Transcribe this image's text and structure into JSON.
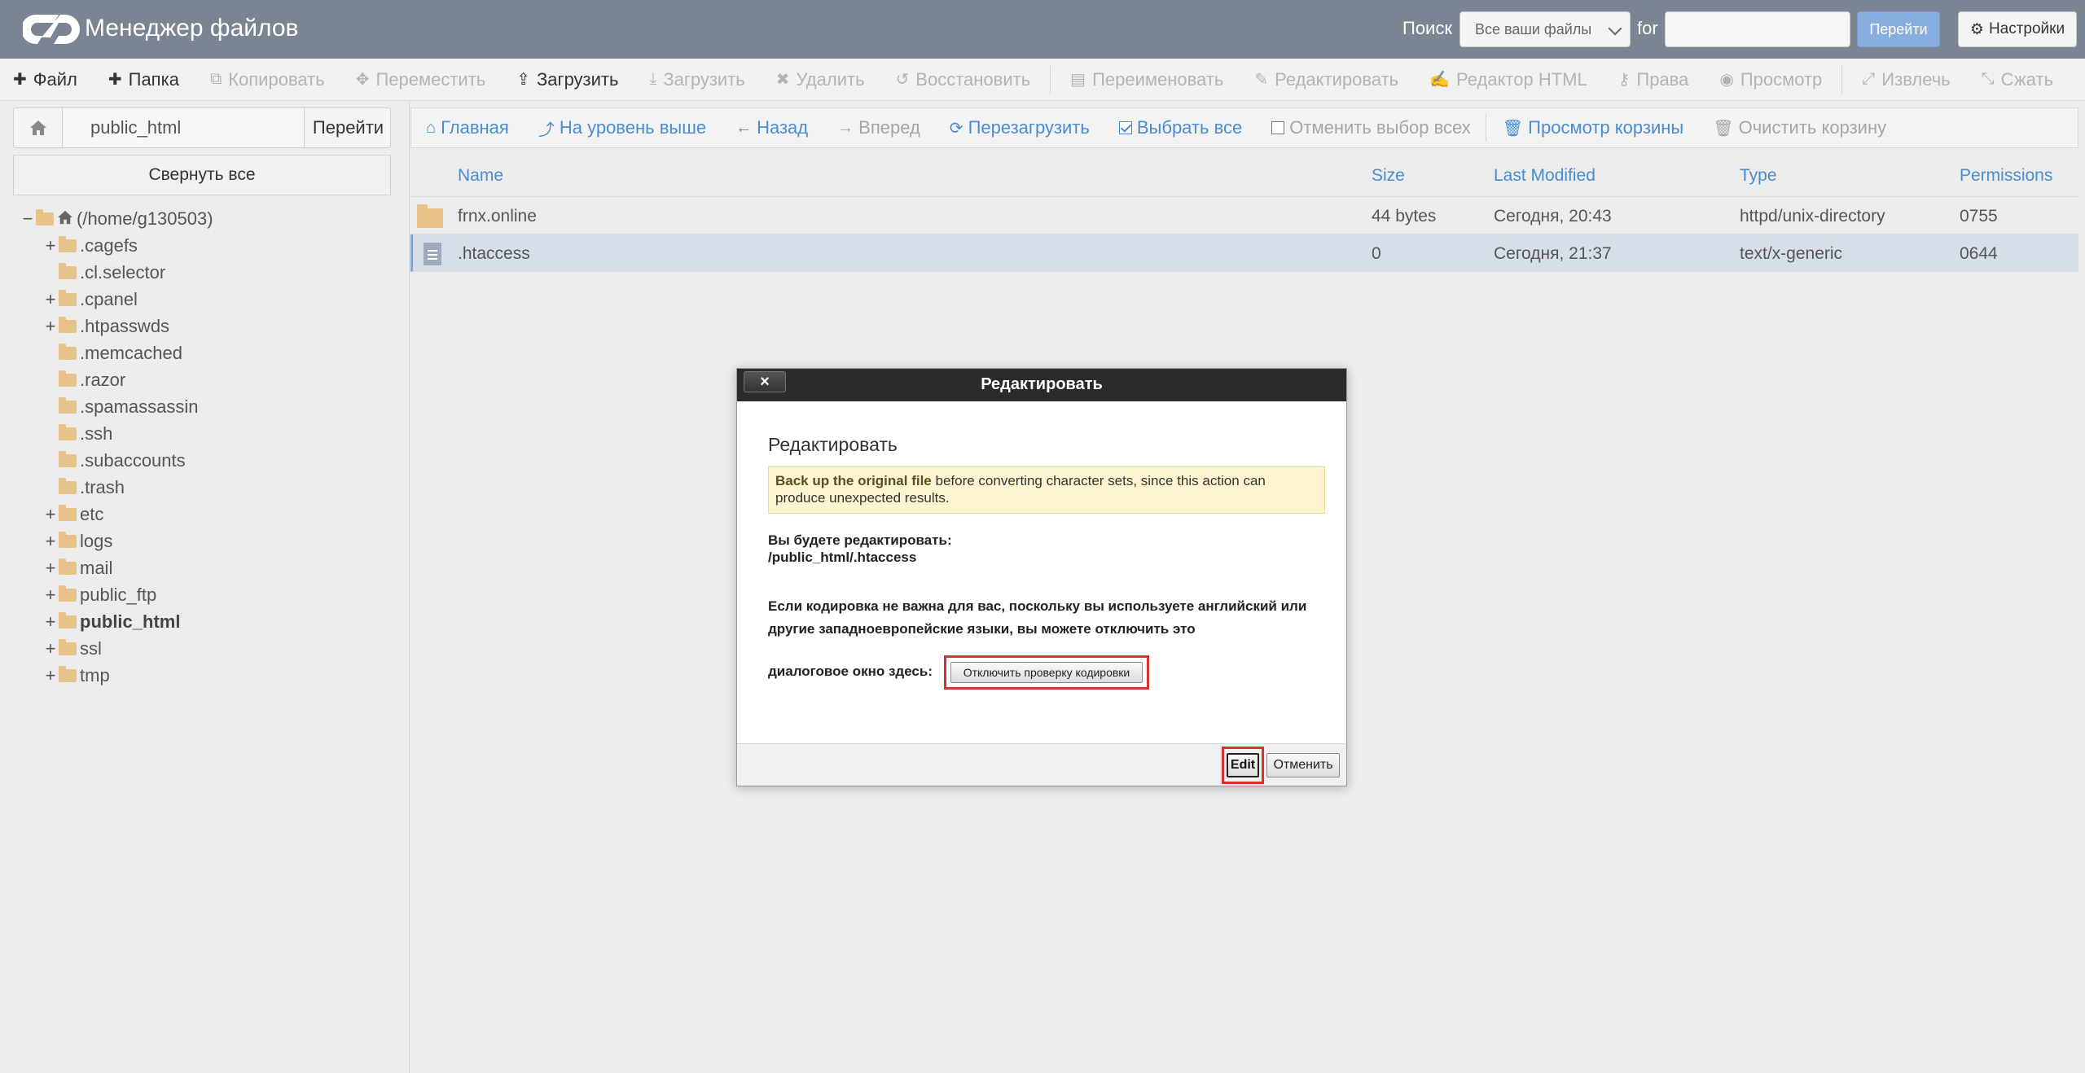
{
  "header": {
    "title": "Менеджер файлов",
    "search_label": "Поиск",
    "search_scope": "Все ваши файлы",
    "for_label": "for",
    "search_value": "",
    "go_label": "Перейти",
    "settings_label": "Настройки"
  },
  "toolbar": {
    "items": [
      {
        "label": "Файл",
        "icon": "plus-icon",
        "enabled": true
      },
      {
        "label": "Папка",
        "icon": "plus-icon",
        "enabled": true
      },
      {
        "label": "Копировать",
        "icon": "copy-icon",
        "enabled": false
      },
      {
        "label": "Переместить",
        "icon": "move-icon",
        "enabled": false
      },
      {
        "label": "Загрузить",
        "icon": "upload-icon",
        "enabled": true
      },
      {
        "label": "Загрузить",
        "icon": "download-icon",
        "enabled": false
      },
      {
        "label": "Удалить",
        "icon": "close-icon",
        "enabled": false
      },
      {
        "label": "Восстановить",
        "icon": "undo-icon",
        "enabled": false
      },
      {
        "label": "Переименовать",
        "icon": "file-icon",
        "enabled": false
      },
      {
        "label": "Редактировать",
        "icon": "pencil-icon",
        "enabled": false
      },
      {
        "label": "Редактор HTML",
        "icon": "edit-icon",
        "enabled": false
      },
      {
        "label": "Права",
        "icon": "key-icon",
        "enabled": false
      },
      {
        "label": "Просмотр",
        "icon": "eye-icon",
        "enabled": false
      },
      {
        "label": "Извлечь",
        "icon": "expand-icon",
        "enabled": false
      },
      {
        "label": "Сжать",
        "icon": "compress-icon",
        "enabled": false
      }
    ]
  },
  "left_panel": {
    "path_value": "public_html",
    "go_label": "Перейти",
    "collapse_label": "Свернуть все",
    "tree": [
      {
        "label": "(/home/g130503)",
        "level": 0,
        "expander": "−",
        "root": true
      },
      {
        "label": ".cagefs",
        "level": 1,
        "expander": "+"
      },
      {
        "label": ".cl.selector",
        "level": 1,
        "expander": ""
      },
      {
        "label": ".cpanel",
        "level": 1,
        "expander": "+"
      },
      {
        "label": ".htpasswds",
        "level": 1,
        "expander": "+"
      },
      {
        "label": ".memcached",
        "level": 1,
        "expander": ""
      },
      {
        "label": ".razor",
        "level": 1,
        "expander": ""
      },
      {
        "label": ".spamassassin",
        "level": 1,
        "expander": ""
      },
      {
        "label": ".ssh",
        "level": 1,
        "expander": ""
      },
      {
        "label": ".subaccounts",
        "level": 1,
        "expander": ""
      },
      {
        "label": ".trash",
        "level": 1,
        "expander": ""
      },
      {
        "label": "etc",
        "level": 1,
        "expander": "+"
      },
      {
        "label": "logs",
        "level": 1,
        "expander": "+"
      },
      {
        "label": "mail",
        "level": 1,
        "expander": "+"
      },
      {
        "label": "public_ftp",
        "level": 1,
        "expander": "+"
      },
      {
        "label": "public_html",
        "level": 1,
        "expander": "+",
        "bold": true
      },
      {
        "label": "ssl",
        "level": 1,
        "expander": "+"
      },
      {
        "label": "tmp",
        "level": 1,
        "expander": "+"
      }
    ]
  },
  "navbar": {
    "items": [
      {
        "label": "Главная",
        "icon": "home-icon",
        "enabled": true
      },
      {
        "label": "На уровень выше",
        "icon": "level-up-icon",
        "enabled": true
      },
      {
        "label": "Назад",
        "icon": "arrow-left-icon",
        "enabled": true
      },
      {
        "label": "Вперед",
        "icon": "arrow-right-icon",
        "enabled": false
      },
      {
        "label": "Перезагрузить",
        "icon": "refresh-icon",
        "enabled": true
      },
      {
        "label": "Выбрать все",
        "icon": "checkbox-checked-icon",
        "enabled": true
      },
      {
        "label": "Отменить выбор всех",
        "icon": "checkbox-empty-icon",
        "enabled": false
      },
      {
        "label": "Просмотр корзины",
        "icon": "trash-icon",
        "enabled": true
      },
      {
        "label": "Очистить корзину",
        "icon": "trash-icon",
        "enabled": false
      }
    ]
  },
  "table": {
    "columns": [
      "Name",
      "Size",
      "Last Modified",
      "Type",
      "Permissions"
    ],
    "rows": [
      {
        "name": "frnx.online",
        "size": "44 bytes",
        "modified": "Сегодня, 20:43",
        "type": "httpd/unix-directory",
        "perms": "0755",
        "kind": "folder",
        "selected": false
      },
      {
        "name": ".htaccess",
        "size": "0",
        "modified": "Сегодня, 21:37",
        "type": "text/x-generic",
        "perms": "0644",
        "kind": "file",
        "selected": true
      }
    ]
  },
  "modal": {
    "close_label": "×",
    "title": "Редактировать",
    "heading": "Редактировать",
    "warning_bold": "Back up the original file",
    "warning_rest": " before converting character sets, since this action can produce unexpected results.",
    "editing_label": "Вы будете редактировать:",
    "editing_path": "/public_html/.htaccess",
    "encoding_text": "Если кодировка не важна для вас, поскольку вы используете английский или другие западноевропейские языки, вы можете отключить это",
    "encoding_tail": "диалоговое окно здесь:",
    "disable_check_label": "Отключить проверку кодировки",
    "edit_label": "Edit",
    "cancel_label": "Отменить"
  },
  "colors": {
    "header_bg": "#7a8492",
    "link_blue": "#4a8ccd",
    "highlight_red": "#d93030",
    "folder": "#e7c38a"
  }
}
